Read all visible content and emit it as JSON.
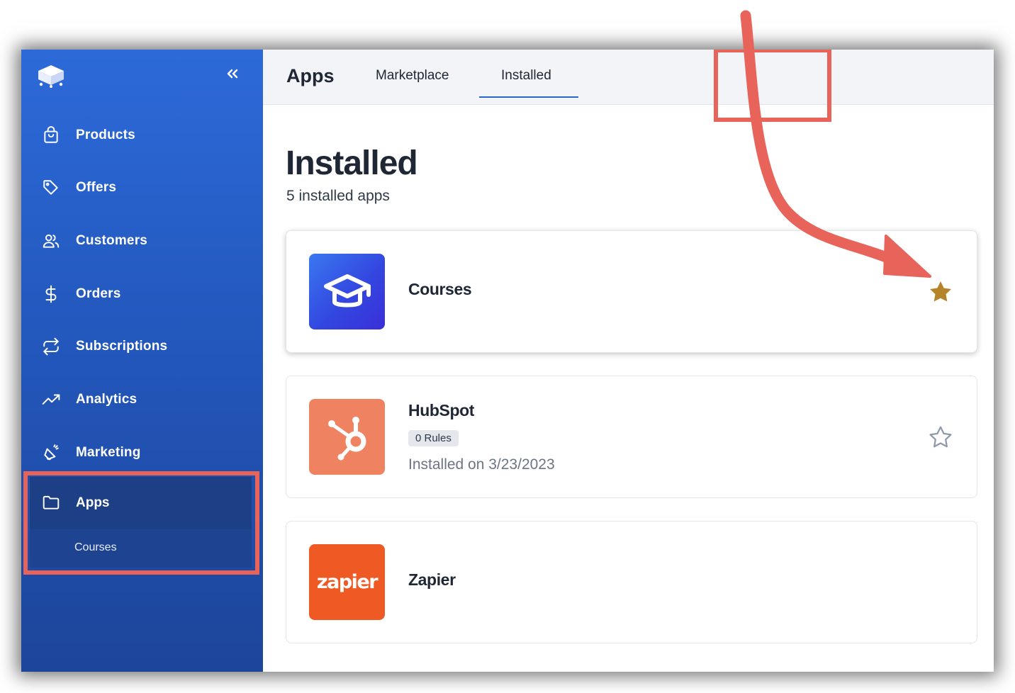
{
  "sidebar": {
    "items": [
      {
        "label": "Products",
        "icon": "shopping-bag-icon"
      },
      {
        "label": "Offers",
        "icon": "tag-icon"
      },
      {
        "label": "Customers",
        "icon": "users-icon"
      },
      {
        "label": "Orders",
        "icon": "dollar-icon"
      },
      {
        "label": "Subscriptions",
        "icon": "repeat-icon"
      },
      {
        "label": "Analytics",
        "icon": "trending-up-icon"
      },
      {
        "label": "Marketing",
        "icon": "megaphone-icon"
      },
      {
        "label": "Apps",
        "icon": "folder-icon"
      }
    ],
    "sub_item": "Courses"
  },
  "header": {
    "title": "Apps",
    "tabs": [
      {
        "label": "Marketplace"
      },
      {
        "label": "Installed",
        "active": true
      }
    ]
  },
  "main": {
    "title": "Installed",
    "subtitle": "5 installed apps",
    "apps": [
      {
        "name": "Courses",
        "favorite": true
      },
      {
        "name": "HubSpot",
        "badge": "0 Rules",
        "installed": "Installed on 3/23/2023",
        "favorite": false
      },
      {
        "name": "Zapier",
        "logo_text": "zapier"
      }
    ]
  },
  "colors": {
    "sidebar": "#2358bd",
    "highlight": "#e8645a",
    "star_filled": "#b5832a",
    "hubspot": "#ef8260",
    "zapier": "#ef5a24",
    "courses_icon": "#3b4de0"
  }
}
